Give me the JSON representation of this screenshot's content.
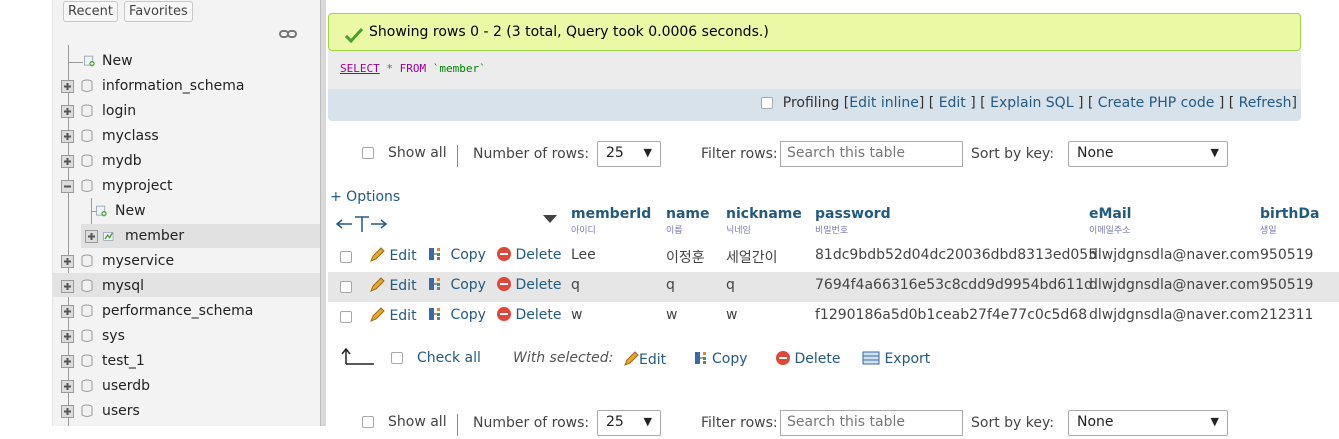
{
  "nav": {
    "tabs": [
      "Recent",
      "Favorites"
    ],
    "tree": [
      {
        "label": "New",
        "type": "new",
        "level": 0
      },
      {
        "label": "information_schema",
        "type": "db",
        "level": 0
      },
      {
        "label": "login",
        "type": "db",
        "level": 0
      },
      {
        "label": "myclass",
        "type": "db",
        "level": 0
      },
      {
        "label": "mydb",
        "type": "db",
        "level": 0
      },
      {
        "label": "myproject",
        "type": "db-open",
        "level": 0
      },
      {
        "label": "New",
        "type": "new",
        "level": 1
      },
      {
        "label": "member",
        "type": "table",
        "level": 1,
        "selected": true
      },
      {
        "label": "myservice",
        "type": "db",
        "level": 0
      },
      {
        "label": "mysql",
        "type": "db",
        "level": 0,
        "hover": true
      },
      {
        "label": "performance_schema",
        "type": "db",
        "level": 0
      },
      {
        "label": "sys",
        "type": "db",
        "level": 0
      },
      {
        "label": "test_1",
        "type": "db",
        "level": 0
      },
      {
        "label": "userdb",
        "type": "db",
        "level": 0
      },
      {
        "label": "users",
        "type": "db",
        "level": 0
      }
    ]
  },
  "result": {
    "message": "Showing rows 0 - 2 (3 total, Query took 0.0006 seconds.)",
    "sql_select": "SELECT",
    "sql_star": "*",
    "sql_from": "FROM",
    "sql_table": "`member`"
  },
  "tools": {
    "profiling": "Profiling",
    "edit_inline": "Edit inline",
    "edit": "Edit",
    "explain": "Explain SQL",
    "php": "Create PHP code",
    "refresh": "Refresh"
  },
  "navbar": {
    "show_all": "Show all",
    "num_rows_label": "Number of rows:",
    "num_rows_value": "25",
    "filter_label": "Filter rows:",
    "filter_placeholder": "Search this table",
    "sort_label": "Sort by key:",
    "sort_value": "None"
  },
  "options": "+ Options",
  "columns": [
    {
      "name": "memberId",
      "comment": "아이디"
    },
    {
      "name": "name",
      "comment": "이름"
    },
    {
      "name": "nickname",
      "comment": "닉네임"
    },
    {
      "name": "password",
      "comment": "비밀번호"
    },
    {
      "name": "eMail",
      "comment": "이메일주소"
    },
    {
      "name": "birthDa",
      "comment": "생일"
    }
  ],
  "actions": {
    "edit": "Edit",
    "copy": "Copy",
    "delete": "Delete"
  },
  "rows": [
    [
      "Lee",
      "이정훈",
      "세얼간이",
      "81dc9bdb52d04dc20036dbd8313ed055",
      "dlwjdgnsdla@naver.com",
      "950519"
    ],
    [
      "q",
      "q",
      "q",
      "7694f4a66316e53c8cdd9d9954bd611d",
      "dlwjdgnsdla@naver.com",
      "950519"
    ],
    [
      "w",
      "w",
      "w",
      "f1290186a5d0b1ceab27f4e77c0c5d68",
      "dlwjdgnsdla@naver.com",
      "212311"
    ]
  ],
  "bulk": {
    "check_all": "Check all",
    "with_selected": "With selected:",
    "edit": "Edit",
    "copy": "Copy",
    "delete": "Delete",
    "export": "Export"
  }
}
